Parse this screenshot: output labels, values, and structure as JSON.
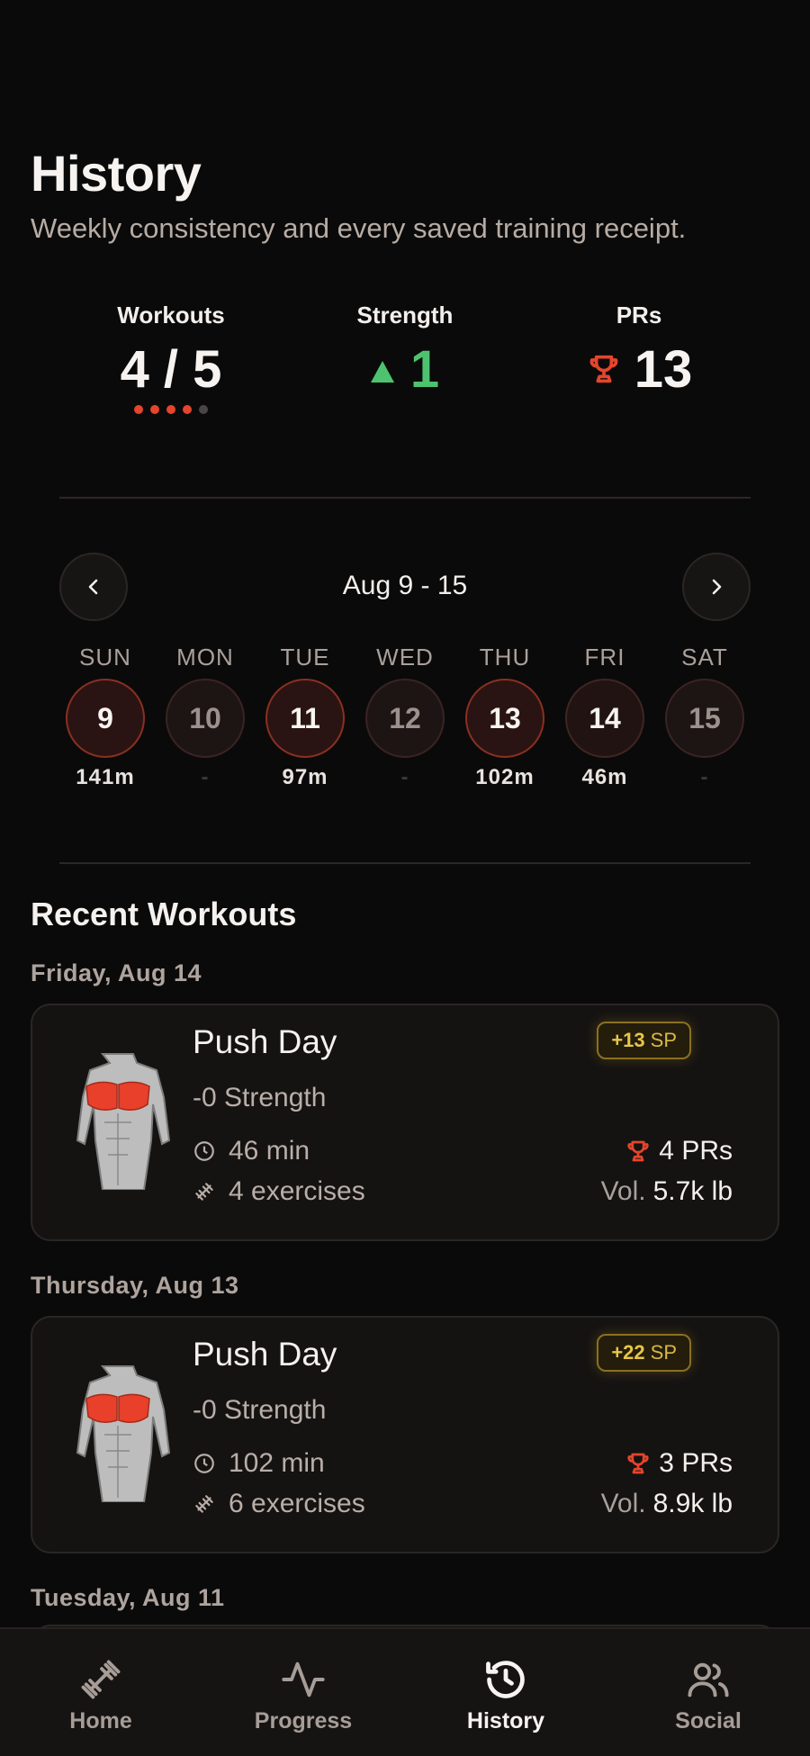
{
  "header": {
    "title": "History",
    "subtitle": "Weekly consistency and every saved training receipt."
  },
  "stats": {
    "workouts": {
      "label": "Workouts",
      "value": "4 / 5",
      "completed": 4,
      "goal": 5
    },
    "strength": {
      "label": "Strength",
      "value": "1",
      "direction": "up",
      "color": "#4ec36f"
    },
    "prs": {
      "label": "PRs",
      "value": "13",
      "icon": "trophy-icon",
      "color": "#e5452c"
    }
  },
  "week": {
    "range": "Aug 9 - 15",
    "prev_icon": "chevron-left-icon",
    "next_icon": "chevron-right-icon",
    "days": [
      {
        "name": "SUN",
        "date": "9",
        "minutes": "141m",
        "active": true
      },
      {
        "name": "MON",
        "date": "10",
        "minutes": "-",
        "active": false
      },
      {
        "name": "TUE",
        "date": "11",
        "minutes": "97m",
        "active": true
      },
      {
        "name": "WED",
        "date": "12",
        "minutes": "-",
        "active": false
      },
      {
        "name": "THU",
        "date": "13",
        "minutes": "102m",
        "active": true
      },
      {
        "name": "FRI",
        "date": "14",
        "minutes": "46m",
        "active": true
      },
      {
        "name": "SAT",
        "date": "15",
        "minutes": "-",
        "active": false
      }
    ]
  },
  "recent": {
    "title": "Recent Workouts",
    "groups": [
      {
        "date": "Friday, Aug 14",
        "workout": {
          "title": "Push Day",
          "strength": "-0 Strength",
          "duration": "46 min",
          "exercises": "4 exercises",
          "sp_value": "+13",
          "sp_unit": "SP",
          "prs": "4 PRs",
          "vol_label": "Vol.",
          "vol_value": "5.7k lb"
        }
      },
      {
        "date": "Thursday, Aug 13",
        "workout": {
          "title": "Push Day",
          "strength": "-0 Strength",
          "duration": "102 min",
          "exercises": "6 exercises",
          "sp_value": "+22",
          "sp_unit": "SP",
          "prs": "3 PRs",
          "vol_label": "Vol.",
          "vol_value": "8.9k lb"
        }
      },
      {
        "date": "Tuesday, Aug 11"
      }
    ]
  },
  "tabbar": {
    "tabs": [
      {
        "label": "Home",
        "icon": "dumbbell-icon",
        "active": false
      },
      {
        "label": "Progress",
        "icon": "pulse-icon",
        "active": false
      },
      {
        "label": "History",
        "icon": "history-icon",
        "active": true
      },
      {
        "label": "Social",
        "icon": "people-icon",
        "active": false
      }
    ]
  },
  "colors": {
    "background": "#0b0a0a",
    "accent": "#e5452c",
    "positive": "#4ec36f",
    "sp_badge": "#e7c648"
  }
}
